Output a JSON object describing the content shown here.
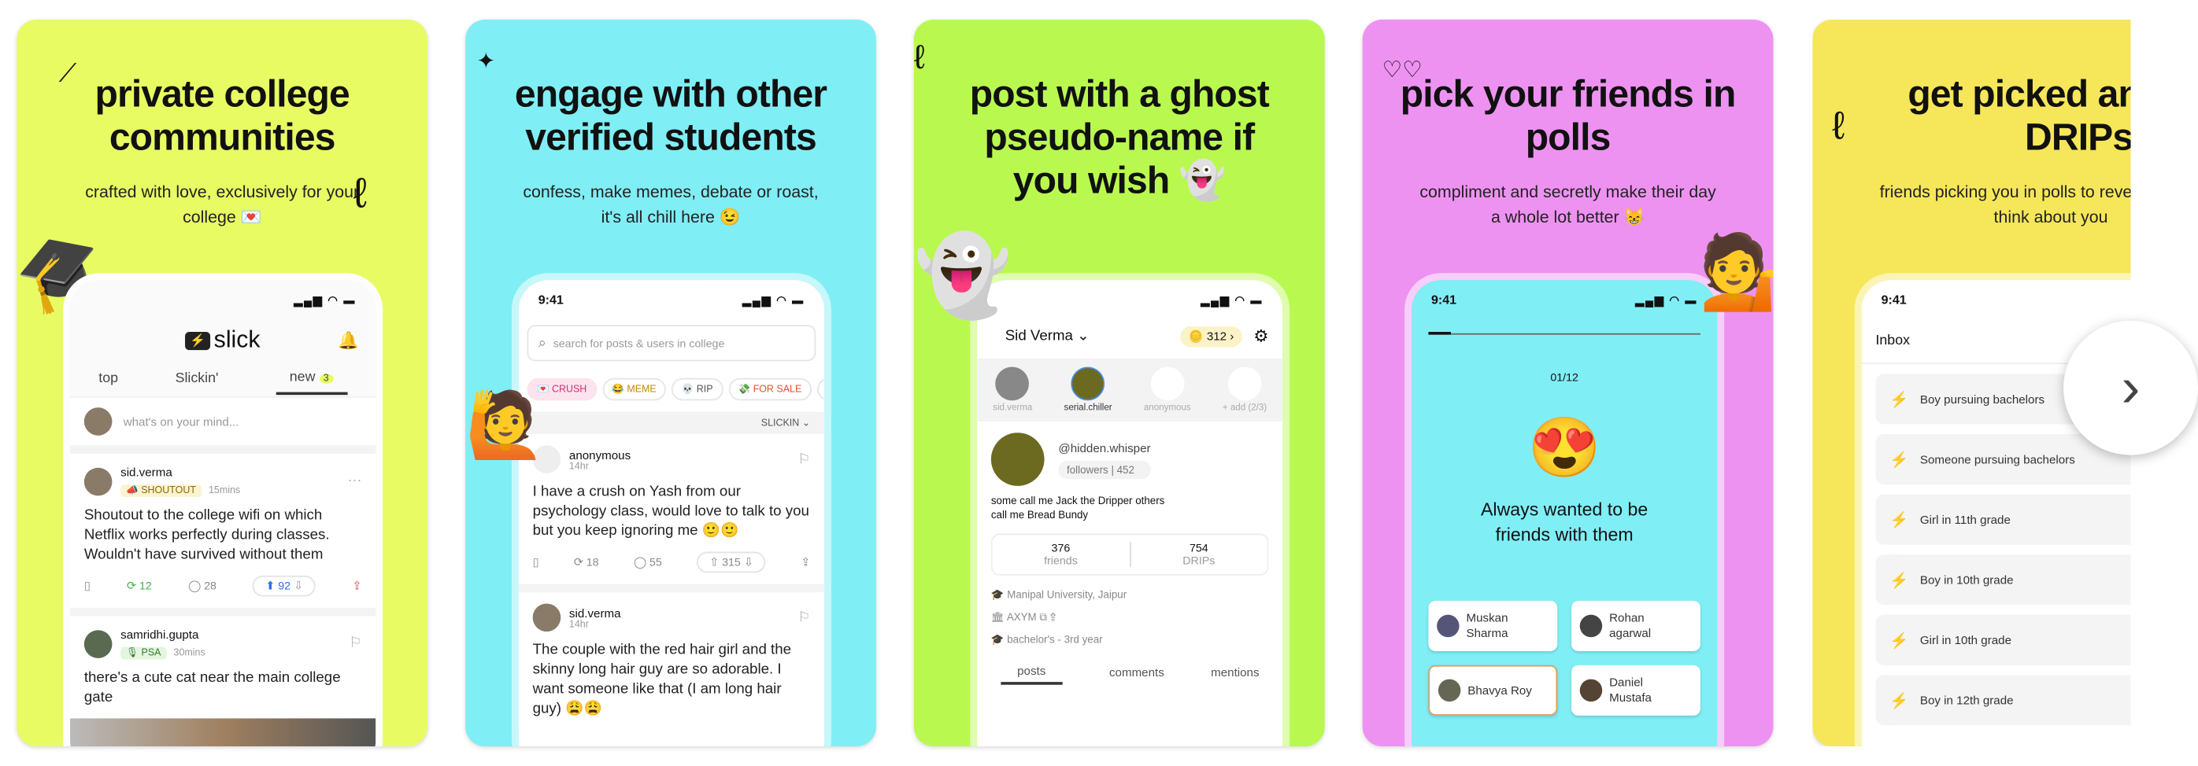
{
  "colors": {
    "card1": "#e8fb63",
    "card2": "#80eef5",
    "card3": "#b9f94f",
    "card4": "#ee92f2",
    "card5": "#f6e65a"
  },
  "cards": [
    {
      "headline": "private college communities",
      "subtitle": "crafted with love, exclusively for your college 💌",
      "app": {
        "logo": "slick",
        "tabs": [
          "top",
          "Slickin'",
          "new"
        ],
        "new_badge": "3",
        "composer_placeholder": "what's on your mind...",
        "posts": [
          {
            "user": "sid.verma",
            "tag": "📣 SHOUTOUT",
            "time": "15mins",
            "text": "Shoutout to the college wifi on which Netflix works perfectly during classes. Wouldn't have survived without them",
            "reposts": "12",
            "comments": "28",
            "votes": "92"
          },
          {
            "user": "samridhi.gupta",
            "tag": "🎙 PSA",
            "time": "30mins",
            "text": "there's a cute cat near the main college gate"
          }
        ]
      }
    },
    {
      "headline": "engage with other verified students",
      "subtitle": "confess, make memes, debate or roast, it's all chill here 😉",
      "app": {
        "time": "9:41",
        "search_placeholder": "search for posts & users in college",
        "chips": [
          "💌 CRUSH",
          "😂 MEME",
          "💀 RIP",
          "💸 FOR SALE",
          "📦 L"
        ],
        "sort": "SLICKIN ⌄",
        "posts": [
          {
            "user": "anonymous",
            "time": "14hr",
            "text": "I have a crush on Yash from our psychology class, would love to talk to you but you keep ignoring me 🙂🙂",
            "reposts": "18",
            "comments": "55",
            "votes": "315"
          },
          {
            "user": "sid.verma",
            "time": "14hr",
            "text": "The couple with the red hair girl and the skinny long hair guy are so adorable. I want someone like that (I am long hair guy) 😩😩"
          }
        ]
      }
    },
    {
      "headline": "post with a ghost pseudo-name if you wish 👻",
      "app": {
        "name": "Sid Verma ⌄",
        "coins": "312 ›",
        "accounts": [
          "sid.verma",
          "serial.chiller",
          "anonymous",
          "+ add (2/3)"
        ],
        "handle": "@hidden.whisper",
        "followers": "followers | 452",
        "bio": "some call me Jack the Dripper others call me Bread Bundy",
        "friends": "376",
        "friends_label": "friends",
        "drips": "754",
        "drips_label": "DRIPs",
        "university": "Manipal University, Jaipur",
        "code": "AXYM",
        "year": "bachelor's - 3rd year",
        "tabs": [
          "posts",
          "comments",
          "mentions"
        ]
      }
    },
    {
      "headline": "pick your friends in polls",
      "subtitle": "compliment and secretly make their day a whole lot better 😸",
      "app": {
        "time": "9:41",
        "progress": "01/12",
        "progress_fraction": 0.083,
        "emoji": "😍",
        "question": "Always wanted to be friends with them",
        "options": [
          "Muskan Sharma",
          "Rohan agarwal",
          "Bhavya Roy",
          "Daniel Mustafa"
        ]
      }
    },
    {
      "headline": "get picked and earn DRIPs",
      "subtitle": "friends picking you in polls to reveal what they think about you",
      "app": {
        "time": "9:41",
        "title": "Inbox",
        "items": [
          {
            "label": "Boy pursuing bachelors",
            "color": "#3ccfe0"
          },
          {
            "label": "Someone pursuing bachelors",
            "color": "#9b5cf0"
          },
          {
            "label": "Girl in 11th grade",
            "color": "#f0447a"
          },
          {
            "label": "Boy in 10th grade",
            "color": "#3ccfe0"
          },
          {
            "label": "Girl in 10th grade",
            "color": "#f0447a"
          },
          {
            "label": "Boy in 12th grade",
            "color": "#3ccfe0"
          }
        ]
      }
    }
  ],
  "next_button": {
    "icon": "chevron-right-icon",
    "glyph": "›"
  }
}
